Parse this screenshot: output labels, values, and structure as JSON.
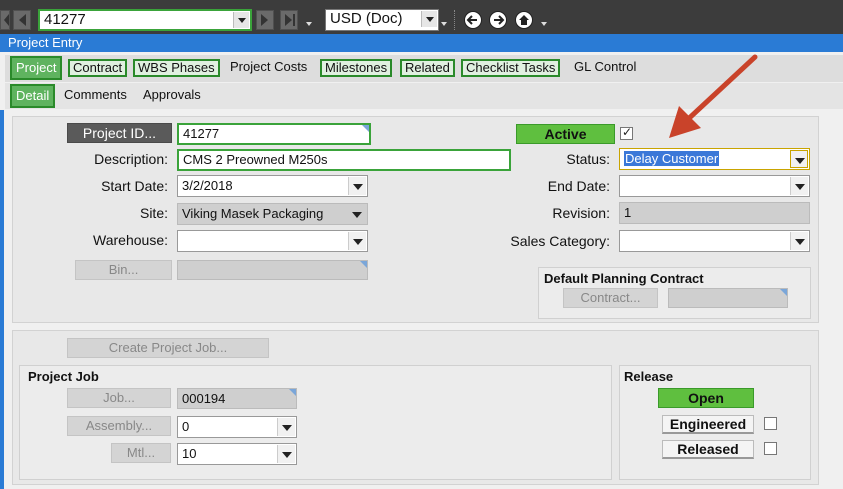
{
  "toolbar": {
    "record_value": "41277",
    "currency_value": "USD (Doc)"
  },
  "window": {
    "title": "Project Entry"
  },
  "main_tabs": [
    {
      "label": "Project"
    },
    {
      "label": "Contract"
    },
    {
      "label": "WBS Phases"
    },
    {
      "label": "Project Costs"
    },
    {
      "label": "Milestones"
    },
    {
      "label": "Related"
    },
    {
      "label": "Checklist Tasks"
    },
    {
      "label": "GL Control"
    }
  ],
  "sub_tabs": [
    {
      "label": "Detail"
    },
    {
      "label": "Comments"
    },
    {
      "label": "Approvals"
    }
  ],
  "detail": {
    "project_id_button": "Project ID...",
    "project_id_value": "41277",
    "description_label": "Description:",
    "description_value": "CMS 2 Preowned M250s",
    "start_date_label": "Start Date:",
    "start_date_value": "3/2/2018",
    "site_label": "Site:",
    "site_value": "Viking Masek Packaging",
    "warehouse_label": "Warehouse:",
    "warehouse_value": "",
    "bin_button": "Bin...",
    "bin_value": "",
    "active_label": "Active",
    "active_checked": true,
    "status_label": "Status:",
    "status_value": "Delay Customer",
    "end_date_label": "End Date:",
    "end_date_value": "",
    "revision_label": "Revision:",
    "revision_value": "1",
    "sales_category_label": "Sales Category:",
    "sales_category_value": "",
    "planning_contract_title": "Default Planning Contract",
    "contract_button": "Contract...",
    "contract_value": ""
  },
  "job": {
    "create_button": "Create Project Job...",
    "section_title": "Project Job",
    "job_button": "Job...",
    "job_value": "000194",
    "assembly_button": "Assembly...",
    "assembly_value": "0",
    "mtl_button": "Mtl...",
    "mtl_value": "10"
  },
  "release": {
    "section_title": "Release",
    "open_label": "Open",
    "engineered_label": "Engineered",
    "engineered_checked": false,
    "released_label": "Released",
    "released_checked": false
  },
  "colors": {
    "accent_green": "#5fbf3f",
    "title_blue": "#2a7bd5",
    "annotation_arrow": "#c9432a"
  }
}
